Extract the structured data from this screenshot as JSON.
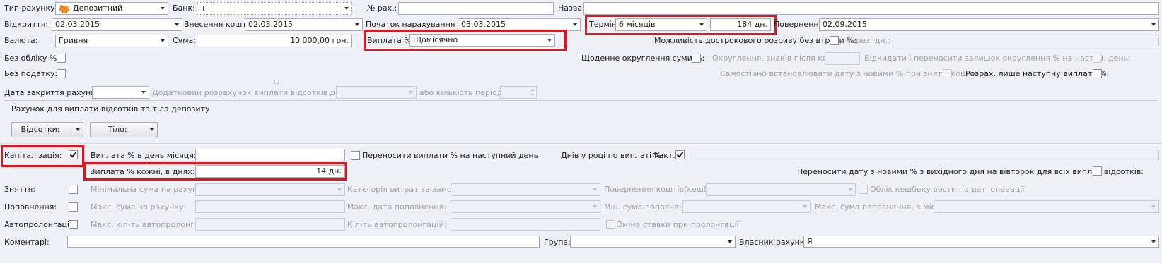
{
  "account_type": {
    "label": "Тип рахунку:",
    "value": "Депозитний"
  },
  "bank": {
    "label": "Банк:",
    "value": "+"
  },
  "account_no": {
    "label": "№ рах.:",
    "value": ""
  },
  "name": {
    "label": "Назва:",
    "value": ""
  },
  "opening": {
    "label": "Відкриття:",
    "value": "02.03.2015"
  },
  "deposit_date": {
    "label": "Внесення коштів:",
    "value": "02.03.2015"
  },
  "accrual_start": {
    "label": "Початок нарахування %:",
    "value": "03.03.2015"
  },
  "term": {
    "label": "Термін:",
    "value": "6 місяців",
    "days": "184 дн."
  },
  "return_date": {
    "label": "Повернення:",
    "value": "02.09.2015"
  },
  "currency": {
    "label": "Валюта:",
    "value": "Гривня"
  },
  "amount": {
    "label": "Сума:",
    "value": "10 000,00 грн."
  },
  "payout": {
    "label": "Виплата %:",
    "value": "Щомісячно"
  },
  "early_termination": {
    "label": "Можливість дострокового розриву без втрати %:",
    "after_label": "через, дн.:",
    "value": ""
  },
  "no_accounting": {
    "label": "Без обліку %:"
  },
  "daily_rounding": {
    "label": "Щоденне округлення суми %:"
  },
  "rounding": {
    "label": "Округлення, знаків після коми:",
    "value": "",
    "carry_label": "Відкидати і переносити залишок округлення % на наступ. день:"
  },
  "no_tax": {
    "label": "Без податку:"
  },
  "self_date": {
    "label": "Самостійно встановлювати дату з новими % при знятті коштів:"
  },
  "calc_next_only": {
    "label": "Розрах. лише наступну виплату %:"
  },
  "close_date": {
    "label": "Дата закриття рахунку:",
    "value": ""
  },
  "extra_calc": {
    "label": "Додатковий розрахунок виплати відсотків до дати:",
    "value": ""
  },
  "periods": {
    "label": "або кількість періодів:",
    "value": ""
  },
  "payout_accounts": {
    "title": "Рахунок для виплати відсотків та тіла депозиту",
    "interest_button": "Відсотки:",
    "body_button": "Тіло:"
  },
  "capitalization": {
    "label": "Капіталізація:",
    "checked": true
  },
  "payout_day": {
    "label": "Виплата % в день місяця:",
    "value": ""
  },
  "move_payouts": {
    "label": "Переносити виплати % на наступний день"
  },
  "days_in_year": {
    "label": "Днів у році по виплаті %:",
    "fact_label": "Факт.",
    "fact_checked": true,
    "value": ""
  },
  "payout_every": {
    "label": "Виплата % кожні, в днях:",
    "value": "14 дн."
  },
  "move_date": {
    "label": "Переносити дату з новими % з вихідного дня на вівторок для всіх виплат відсотків:"
  },
  "withdrawal": {
    "label": "Зняття:",
    "min_sum": "Мінімальна сума на рахунку:",
    "category": "Категорія витрат за замов.:",
    "cashback": "Повернення коштів(кешбек):",
    "cashback_date": "Облік кешбеку вести по даті операції"
  },
  "topup": {
    "label": "Поповнення:",
    "max_sum": "Макс. сума на рахунку:",
    "max_date": "Макс. дата поповнення:",
    "min_topup": "Мін. сума поповнення:",
    "max_monthly": "Макс. сума поповнення, в місяць:"
  },
  "autoprolong": {
    "label": "Автопролонгація:",
    "max_count": "Макс. кіл-ть автопролонг.:",
    "count": "Кіл-ть автопролонгацій:",
    "rate_change": "Зміна ставки при пролонгації"
  },
  "comments": {
    "label": "Коментарі:",
    "value": ""
  },
  "group": {
    "label": "Група:",
    "value": ""
  },
  "owner": {
    "label": "Власник рахунку:",
    "value": "Я"
  },
  "colors": {
    "highlight": "#e0161c",
    "background": "#eff0f5",
    "piggy": "#f08a1c"
  }
}
